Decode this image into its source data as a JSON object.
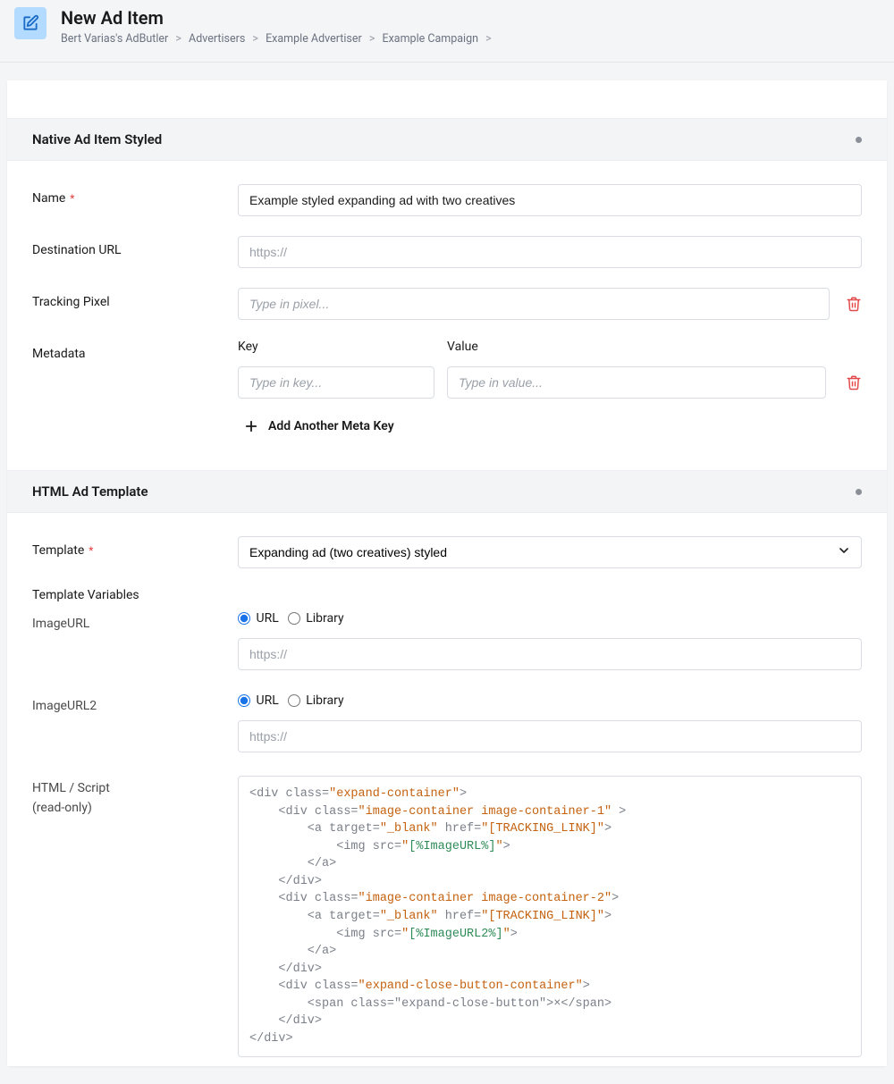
{
  "header": {
    "title": "New Ad Item",
    "breadcrumbs": [
      "Bert Varias's AdButler",
      "Advertisers",
      "Example Advertiser",
      "Example Campaign"
    ]
  },
  "section_styled": {
    "title": "Native Ad Item Styled",
    "fields": {
      "name_label": "Name",
      "name_value": "Example styled expanding ad with two creatives",
      "dest_label": "Destination URL",
      "dest_placeholder": "https://",
      "pixel_label": "Tracking Pixel",
      "pixel_placeholder": "Type in pixel...",
      "metadata_label": "Metadata",
      "key_label": "Key",
      "value_label": "Value",
      "key_placeholder": "Type in key...",
      "value_placeholder": "Type in value...",
      "add_meta_label": "Add Another Meta Key"
    }
  },
  "section_template": {
    "title": "HTML Ad Template",
    "template_label": "Template",
    "template_value": "Expanding ad (two creatives) styled",
    "tv_label": "Template Variables",
    "imageurl_label": "ImageURL",
    "imageurl2_label": "ImageURL2",
    "radio_url": "URL",
    "radio_library": "Library",
    "https_placeholder": "https://",
    "htmlscript_label": "HTML / Script",
    "readonly_note": "(read-only)",
    "code_lines": [
      {
        "indent": 0,
        "type": "open",
        "tag": "div",
        "attrs": [
          {
            "n": "class",
            "v": "expand-container"
          }
        ]
      },
      {
        "indent": 1,
        "type": "open",
        "tag": "div",
        "attrs": [
          {
            "n": "class",
            "v": "image-container image-container-1"
          }
        ],
        "trail": " >"
      },
      {
        "indent": 2,
        "type": "open",
        "tag": "a",
        "attrs": [
          {
            "n": "target",
            "v": "_blank"
          },
          {
            "n": "href",
            "v": "[TRACKING_LINK]"
          }
        ]
      },
      {
        "indent": 3,
        "type": "selfclose",
        "tag": "img",
        "attrs": [
          {
            "n": "src",
            "v": "[%ImageURL%]",
            "hl": true
          }
        ]
      },
      {
        "indent": 2,
        "type": "close",
        "tag": "a"
      },
      {
        "indent": 1,
        "type": "close",
        "tag": "div"
      },
      {
        "indent": 1,
        "type": "open",
        "tag": "div",
        "attrs": [
          {
            "n": "class",
            "v": "image-container image-container-2"
          }
        ]
      },
      {
        "indent": 2,
        "type": "open",
        "tag": "a",
        "attrs": [
          {
            "n": "target",
            "v": "_blank"
          },
          {
            "n": "href",
            "v": "[TRACKING_LINK]"
          }
        ]
      },
      {
        "indent": 3,
        "type": "selfclose",
        "tag": "img",
        "attrs": [
          {
            "n": "src",
            "v": "[%ImageURL2%]",
            "hl": true
          }
        ]
      },
      {
        "indent": 2,
        "type": "close",
        "tag": "a"
      },
      {
        "indent": 1,
        "type": "close",
        "tag": "div"
      },
      {
        "indent": 1,
        "type": "open",
        "tag": "div",
        "attrs": [
          {
            "n": "class",
            "v": "expand-close-button-container"
          }
        ]
      },
      {
        "indent": 2,
        "type": "raw",
        "raw": "<span class=\"expand-close-button\">×</span>"
      },
      {
        "indent": 1,
        "type": "close",
        "tag": "div"
      },
      {
        "indent": 0,
        "type": "close",
        "tag": "div"
      }
    ]
  }
}
